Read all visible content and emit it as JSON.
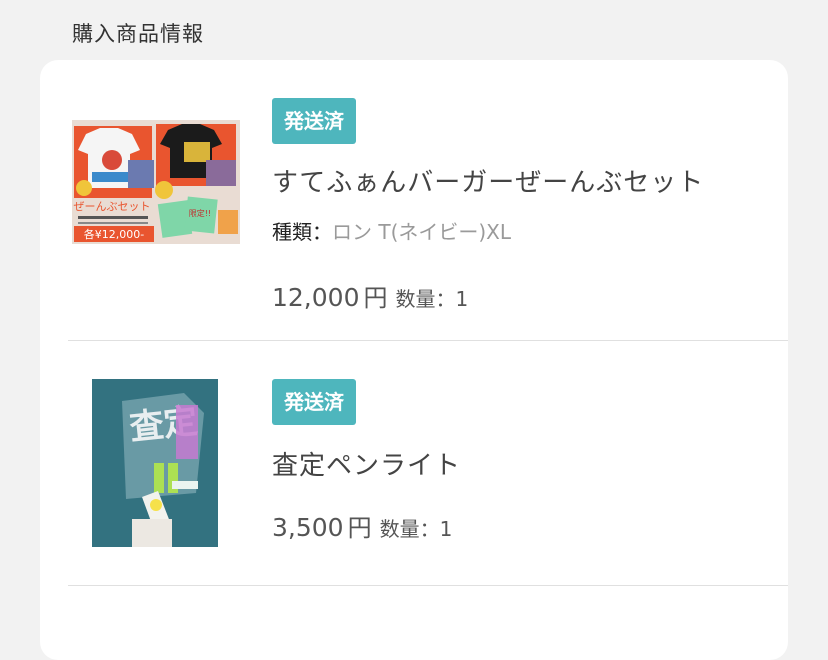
{
  "section": {
    "title": "購入商品情報"
  },
  "items": [
    {
      "status": "発送済",
      "name": "すてふぁんバーガーぜーんぶセット",
      "variant_key": "種類：",
      "variant_value": "ロン T(ネイビー)XL",
      "price": "12,000",
      "currency": "円",
      "quantity": "数量：1",
      "image_text": {
        "title": "ぜーんぶセット",
        "price": "各¥12,000-",
        "badge": "限定!!"
      }
    },
    {
      "status": "発送済",
      "name": "査定ペンライト",
      "price": "3,500",
      "currency": "円",
      "quantity": "数量：1",
      "image_text": {
        "big": "査定"
      }
    }
  ],
  "colors": {
    "badge": "#4eb6bd",
    "background": "#f2f2f2",
    "card": "#ffffff"
  }
}
